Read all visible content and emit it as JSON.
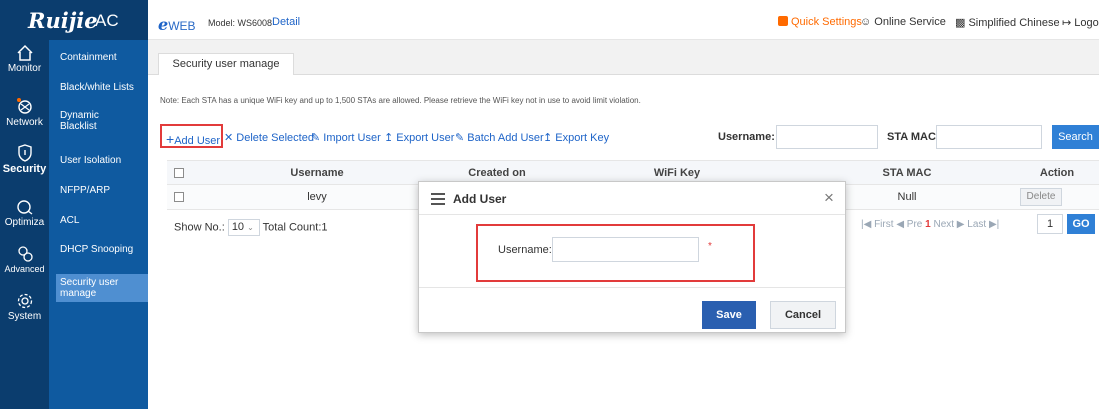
{
  "brand": {
    "name": "Ruijie",
    "product": "AC"
  },
  "header": {
    "eweb_prefix": "e",
    "eweb_text": "WEB",
    "model": "Model: WS6008",
    "detail": "Detail",
    "quick_settings": "Quick Settings",
    "online_service": "Online Service",
    "language": "Simplified Chinese",
    "logout": "Logo"
  },
  "rail": [
    {
      "label": "Monitor",
      "icon": "home-icon"
    },
    {
      "label": "Network",
      "icon": "network-icon"
    },
    {
      "label": "Security",
      "icon": "shield-icon"
    },
    {
      "label": "Optimiza",
      "icon": "optimize-icon"
    },
    {
      "label": "Advanced",
      "icon": "advanced-icon"
    },
    {
      "label": "System",
      "icon": "gear-icon"
    }
  ],
  "nav": [
    {
      "label": "Containment"
    },
    {
      "label": "Black/white Lists"
    },
    {
      "label": "Dynamic Blacklist"
    },
    {
      "label": "User Isolation"
    },
    {
      "label": "NFPP/ARP"
    },
    {
      "label": "ACL"
    },
    {
      "label": "DHCP Snooping"
    },
    {
      "label": "Security user manage"
    }
  ],
  "tab": "Security user manage",
  "note": "Note: Each STA has a unique WiFi key and up to 1,500 STAs are allowed. Please retrieve the WiFi key not in use to avoid limit violation.",
  "toolbar": {
    "add_user": "Add User",
    "delete_selected": "Delete Selected",
    "import_user": "Import User",
    "export_user": "Export User",
    "batch_add_user": "Batch Add User",
    "export_key": "Export Key",
    "username_label": "Username:",
    "sta_mac_label": "STA MAC:",
    "search": "Search"
  },
  "table": {
    "columns": [
      "Username",
      "Created on",
      "WiFi Key",
      "STA MAC",
      "Action"
    ],
    "rows": [
      {
        "username": "levy",
        "sta_mac": "Null",
        "action": "Delete"
      }
    ]
  },
  "pager": {
    "show_no_label": "Show No.:",
    "page_size": "10",
    "total": "Total Count:1",
    "first": "First",
    "pre": "Pre",
    "current": "1",
    "next": "Next",
    "last": "Last",
    "page_input": "1",
    "go": "GO"
  },
  "modal": {
    "title": "Add User",
    "username_label": "Username:",
    "required_mark": "*",
    "save": "Save",
    "cancel": "Cancel"
  },
  "colors": {
    "accent": "#2f80d6",
    "highlight": "#e23b3b",
    "nav": "#0f5aa0",
    "rail": "#0b3d6e",
    "quick": "#ff6a00"
  }
}
